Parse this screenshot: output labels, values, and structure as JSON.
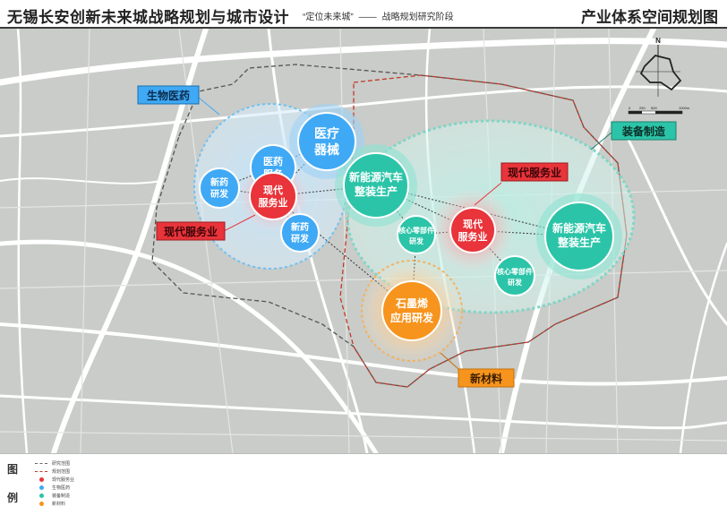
{
  "header": {
    "title": "无锡长安创新未来城战略规划与城市设计",
    "subtitle_quote": "“定位未来城”",
    "subtitle_dash": "——",
    "subtitle_stage": "战略规划研究阶段",
    "right_title": "产业体系空间规划图"
  },
  "map": {
    "north_label": "N",
    "scale_labels": [
      "0",
      "250",
      "500",
      "1000m"
    ],
    "cluster_labels": {
      "bio": "生物医药",
      "equip": "装备制造",
      "service_top": "现代服务业",
      "service_left": "现代服务业",
      "material": "新材料"
    },
    "nodes": {
      "medical_service": [
        "医药",
        "服务"
      ],
      "medical_device": [
        "医疗",
        "器械"
      ],
      "new_drug_left": [
        "新药",
        "研发"
      ],
      "modern_service_left": [
        "现代",
        "服务业"
      ],
      "new_drug_bottom": [
        "新药",
        "研发"
      ],
      "nev_left": [
        "新能源汽车",
        "整装生产"
      ],
      "core_parts_left": [
        "核心零部件",
        "研发"
      ],
      "modern_service_center": [
        "现代",
        "服务业"
      ],
      "nev_right": [
        "新能源汽车",
        "整装生产"
      ],
      "core_parts_right": [
        "核心零部件",
        "研发"
      ],
      "graphene": [
        "石墨烯",
        "应用研发"
      ]
    },
    "colors": {
      "blue": "#3fa9f5",
      "teal": "#2cc4a8",
      "red": "#e8343a",
      "orange": "#f7941d"
    }
  },
  "legend": {
    "title_top": "图",
    "title_bottom": "例",
    "items": [
      {
        "label": "研究范围"
      },
      {
        "label": "规划范围"
      },
      {
        "label": "现代服务业"
      },
      {
        "label": "生物医药"
      },
      {
        "label": "装备制造"
      },
      {
        "label": "新材料"
      }
    ]
  }
}
